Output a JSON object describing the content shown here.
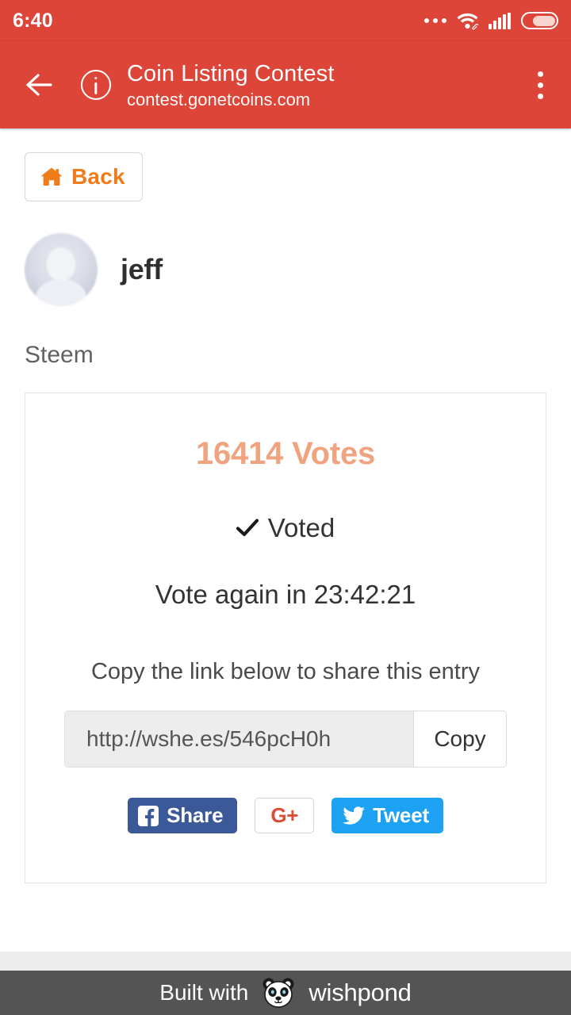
{
  "status_bar": {
    "time": "6:40",
    "icons": [
      "more-dots-icon",
      "wifi-icon",
      "signal-icon",
      "battery-icon"
    ]
  },
  "browser_header": {
    "back_icon": "back-arrow-icon",
    "info_icon": "info-circle-icon",
    "title": "Coin Listing Contest",
    "url": "contest.gonetcoins.com",
    "menu_icon": "overflow-menu-icon",
    "background_color": "#dd4539"
  },
  "page": {
    "back_button": {
      "label": "Back",
      "icon": "home-icon",
      "color": "#ef7c18"
    },
    "profile": {
      "avatar": "default-avatar",
      "username": "jeff"
    },
    "entry_name": "Steem",
    "vote_card": {
      "vote_count_text": "16414 Votes",
      "vote_count": 16414,
      "vote_count_color": "#f0a37f",
      "voted_label": "Voted",
      "voted_icon": "checkmark-icon",
      "vote_again_text": "Vote again in 23:42:21",
      "countdown": "23:42:21",
      "share_hint": "Copy the link below to share this entry",
      "share_url": "http://wshe.es/546pcH0h",
      "copy_button_label": "Copy",
      "social_buttons": [
        {
          "network": "facebook",
          "label": "Share",
          "icon": "facebook-icon",
          "color": "#3b5998"
        },
        {
          "network": "googleplus",
          "label": "G+",
          "icon": "googleplus-icon",
          "color": "#dd4b39"
        },
        {
          "network": "twitter",
          "label": "Tweet",
          "icon": "twitter-icon",
          "color": "#1da1f2"
        }
      ]
    }
  },
  "footer": {
    "built_with": "Built with",
    "brand": "wishpond",
    "logo": "panda-logo",
    "background_color": "#545454"
  }
}
